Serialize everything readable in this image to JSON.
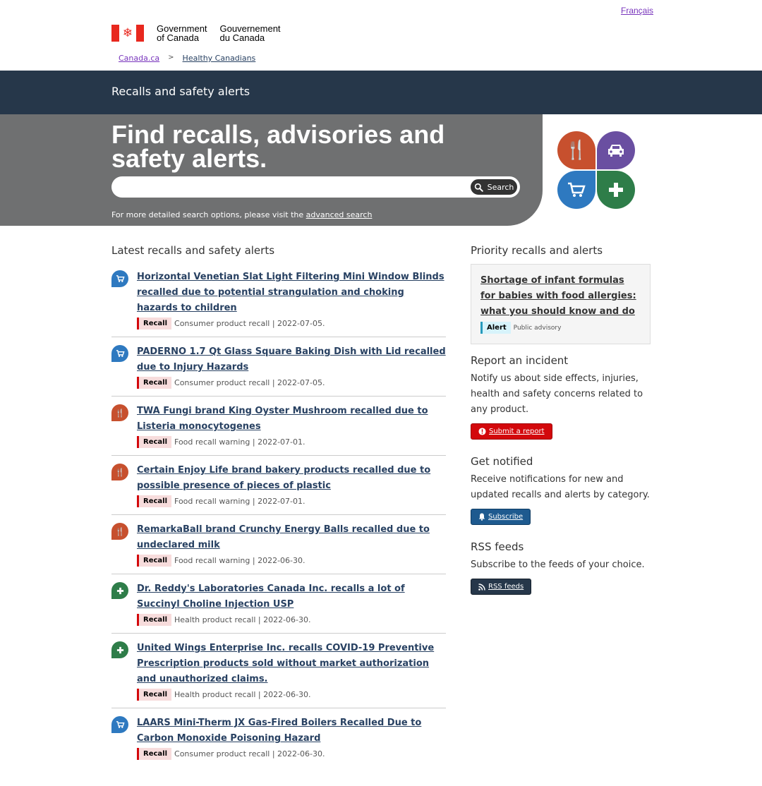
{
  "header": {
    "language_link": "Français",
    "gov_en_line1": "Government",
    "gov_en_line2": "of Canada",
    "gov_fr_line1": "Gouvernement",
    "gov_fr_line2": "du Canada",
    "breadcrumb": [
      "Canada.ca",
      "Healthy Canadians"
    ],
    "breadcrumb_separator": ">",
    "site_title": "Recalls and safety alerts"
  },
  "hero": {
    "heading": "Find recalls, advisories and safety alerts.",
    "search_placeholder": "",
    "search_button": "Search",
    "advanced_prefix": "For more detailed search options, please visit the",
    "advanced_link": "advanced search"
  },
  "latest": {
    "heading": "Latest recalls and safety alerts",
    "items": [
      {
        "category": "consumer",
        "icon": "cart-icon",
        "title": "Horizontal Venetian Slat Light Filtering Mini Window Blinds recalled due to potential strangulation and choking hazards to children",
        "tag": "Recall",
        "meta": "Consumer product recall | 2022-07-05."
      },
      {
        "category": "consumer",
        "icon": "cart-icon",
        "title": "PADERNO 1.7 Qt Glass Square Baking Dish with Lid recalled due to Injury Hazards",
        "tag": "Recall",
        "meta": "Consumer product recall | 2022-07-05."
      },
      {
        "category": "food",
        "icon": "utensils-icon",
        "title": "TWA Fungi brand King Oyster Mushroom recalled due to Listeria monocytogenes",
        "tag": "Recall",
        "meta": "Food recall warning | 2022-07-01."
      },
      {
        "category": "food",
        "icon": "utensils-icon",
        "title": "Certain Enjoy Life brand bakery products recalled due to possible presence of pieces of plastic",
        "tag": "Recall",
        "meta": "Food recall warning | 2022-07-01."
      },
      {
        "category": "food",
        "icon": "utensils-icon",
        "title": "RemarkaBall brand Crunchy Energy Balls recalled due to undeclared milk",
        "tag": "Recall",
        "meta": "Food recall warning | 2022-06-30."
      },
      {
        "category": "health",
        "icon": "plus-icon",
        "title": "Dr. Reddy's Laboratories Canada Inc. recalls a lot of Succinyl Choline Injection USP",
        "tag": "Recall",
        "meta": "Health product recall | 2022-06-30."
      },
      {
        "category": "health",
        "icon": "plus-icon",
        "title": "United Wings Enterprise Inc. recalls COVID-19 Preventive Prescription products sold without market authorization and unauthorized claims.",
        "tag": "Recall",
        "meta": "Health product recall | 2022-06-30."
      },
      {
        "category": "consumer",
        "icon": "cart-icon",
        "title": "LAARS Mini-Therm JX Gas-Fired Boilers Recalled Due to Carbon Monoxide Poisoning Hazard",
        "tag": "Recall",
        "meta": "Consumer product recall | 2022-06-30."
      }
    ]
  },
  "sidebar": {
    "priority_heading": "Priority recalls and alerts",
    "priority_title": "Shortage of infant formulas for babies with food allergies: what you should know and do",
    "priority_tag": "Alert",
    "priority_meta": "Public advisory",
    "report_heading": "Report an incident",
    "report_text": "Notify us about side effects, injuries, health and safety concerns related to any product.",
    "report_button": "Submit a report",
    "notify_heading": "Get notified",
    "notify_text": "Receive notifications for new and updated recalls and alerts by category.",
    "notify_button": "Subscribe",
    "rss_heading": "RSS feeds",
    "rss_text": "Subscribe to the feeds of your choice.",
    "rss_button": "RSS feeds"
  },
  "colors": {
    "food": "#c7502e",
    "vehicle": "#6a4fa1",
    "consumer": "#2e79c0",
    "health": "#2e7d49",
    "recall_tag": "#d3080c",
    "header_bar": "#26374a"
  }
}
